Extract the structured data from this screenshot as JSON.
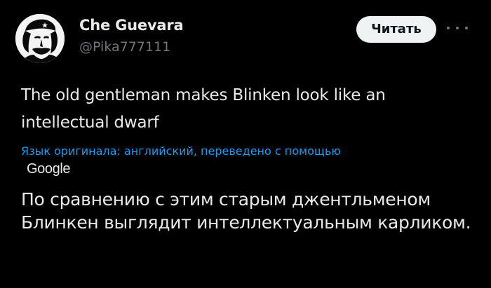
{
  "author": {
    "display_name": "Che Guevara",
    "handle": "@Pika777111",
    "avatar_icon": "che-guevara-portrait"
  },
  "actions": {
    "read_label": "Читать",
    "more_icon": "more-horizontal-icon"
  },
  "tweet": {
    "text": "The old gentleman makes Blinken look like an intellectual dwarf",
    "translation_note": "Язык оригинала: английский, переведено с помощью",
    "translation_provider": "Google",
    "translated_text": "По сравнению с этим старым джентльменом Блинкен выглядит интеллектуальным карликом."
  },
  "colors": {
    "background": "#000000",
    "primary_text": "#e7e9ea",
    "secondary_text": "#71767b",
    "link": "#1d9bf0",
    "button_bg": "#eff3f4",
    "button_text": "#0f1419"
  }
}
